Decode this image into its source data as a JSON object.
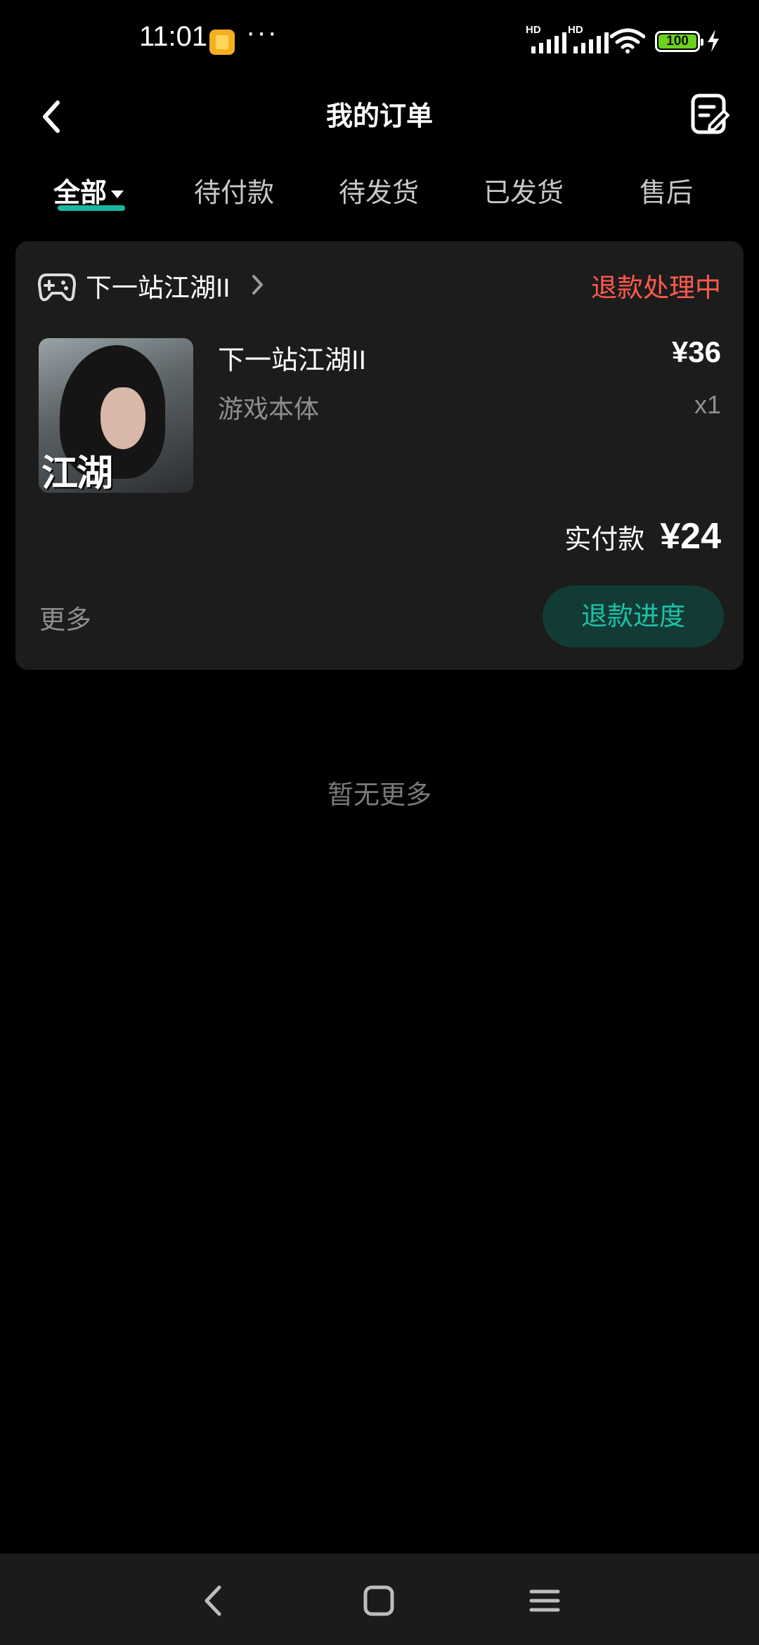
{
  "status_bar": {
    "time": "11:01",
    "more": "···",
    "signal1_label": "HD",
    "signal2_label": "HD",
    "battery": "100"
  },
  "header": {
    "title": "我的订单"
  },
  "tabs": [
    {
      "label": "全部"
    },
    {
      "label": "待付款"
    },
    {
      "label": "待发货"
    },
    {
      "label": "已发货"
    },
    {
      "label": "售后"
    }
  ],
  "order": {
    "store_name": "下一站江湖II",
    "status": "退款处理中",
    "status_color": "#ff5a4b",
    "product_name": "下一站江湖II",
    "cover_text": "江湖",
    "variant": "游戏本体",
    "price": "¥36",
    "quantity": "x1",
    "paid_label": "实付款",
    "paid_amount": "¥24",
    "more_label": "更多",
    "action_button": "退款进度"
  },
  "empty_text": "暂无更多",
  "accent_color": "#17b8a0",
  "icons": [
    "back-icon",
    "order-edit-icon",
    "gamepad-icon",
    "chevron-right-icon",
    "nav-back-icon",
    "nav-home-icon",
    "nav-menu-icon"
  ]
}
